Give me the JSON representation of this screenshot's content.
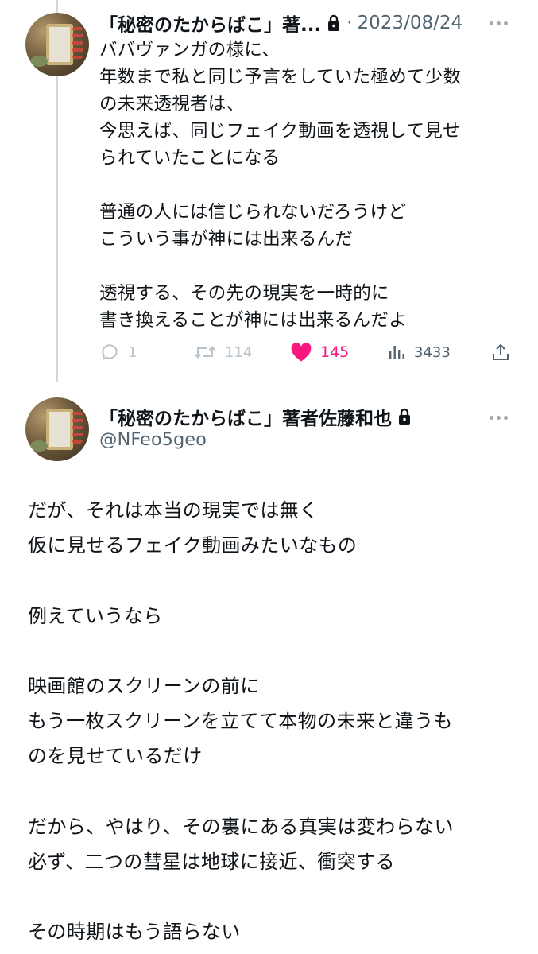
{
  "tweet1": {
    "display_name": "「秘密のたからばこ」著...",
    "separator": "·",
    "date": "2023/08/24",
    "text": "ババヴァンガの様に、\n年数まで私と同じ予言をしていた極めて少数\nの未来透視者は、\n今思えば、同じフェイク動画を透視して見せ\nられていたことになる\n\n普通の人には信じられないだろうけど\nこういう事が神には出来るんだ\n\n透視する、その先の現実を一時的に\n書き換えることが神には出来るんだよ",
    "actions": {
      "replies": "1",
      "retweets": "114",
      "likes": "145",
      "views": "3433"
    },
    "icons": [
      "reply-icon",
      "retweet-icon",
      "heart-icon",
      "views-icon",
      "share-icon"
    ]
  },
  "tweet2": {
    "display_name": "「秘密のたからばこ」著者佐藤和也",
    "handle": "@NFeo5geo",
    "text": "だが、それは本当の現実では無く\n仮に見せるフェイク動画みたいなもの\n\n例えていうなら\n\n映画館のスクリーンの前に\nもう一枚スクリーンを立てて本物の未来と違うも\nのを見せているだけ\n\nだから、やはり、その裏にある真実は変わらない\n必ず、二つの彗星は地球に接近、衝突する\n\nその時期はもう語らない"
  },
  "colors": {
    "like_active": "#f91880",
    "muted": "#536471",
    "icon_muted": "#a0aab3",
    "thread_line": "#cfd9de"
  }
}
